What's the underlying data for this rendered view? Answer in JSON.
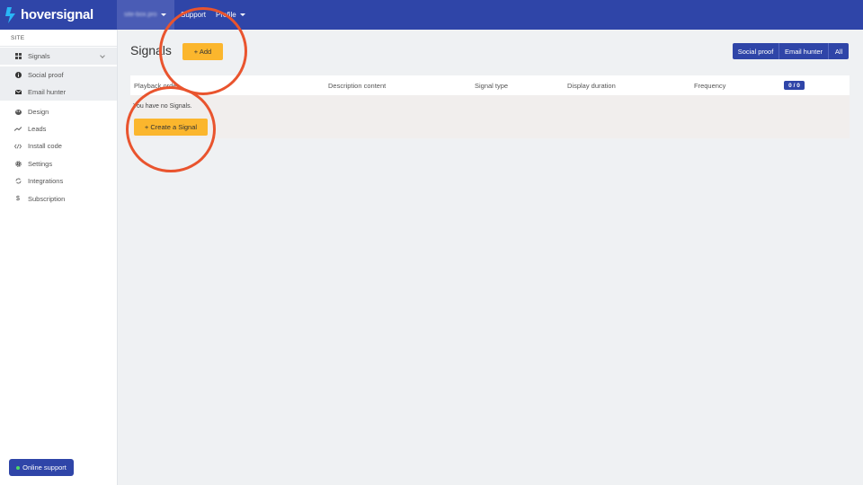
{
  "brand": {
    "name": "hoversignal"
  },
  "topbar": {
    "site_selector": "site-box.pro",
    "support": "Support",
    "profile": "Profile"
  },
  "sidebar": {
    "section_label": "SITE",
    "items": [
      {
        "label": "Signals",
        "icon": "grid-icon"
      },
      {
        "label": "Social proof",
        "icon": "info-circle-icon"
      },
      {
        "label": "Email hunter",
        "icon": "envelope-icon"
      },
      {
        "label": "Design",
        "icon": "palette-icon"
      },
      {
        "label": "Leads",
        "icon": "trend-line-icon"
      },
      {
        "label": "Install code",
        "icon": "code-icon"
      },
      {
        "label": "Settings",
        "icon": "gear-icon"
      },
      {
        "label": "Integrations",
        "icon": "sync-icon"
      },
      {
        "label": "Subscription",
        "icon": "dollar-icon"
      }
    ],
    "online_support": "Online support"
  },
  "main": {
    "title": "Signals",
    "add_button": "+ Add",
    "filters": [
      "Social proof",
      "Email hunter",
      "All"
    ],
    "table": {
      "columns": [
        "Playback order",
        "Description content",
        "Signal type",
        "Display duration",
        "Frequency"
      ],
      "count": "0 / 0"
    },
    "empty_message": "You have no Signals.",
    "create_button": "+ Create a Signal"
  },
  "colors": {
    "primary": "#2f45a8",
    "accent": "#fbb62d",
    "annotation": "#e9542e"
  }
}
